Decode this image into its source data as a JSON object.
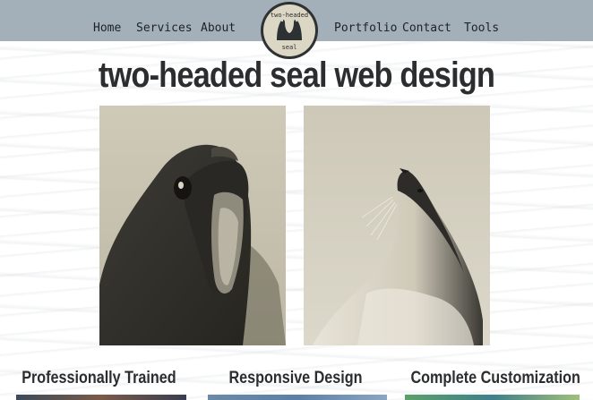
{
  "nav": {
    "left": [
      "Home",
      "Services",
      "About"
    ],
    "right": [
      "Portfolio",
      "Contact",
      "Tools"
    ]
  },
  "logo": {
    "top_text": "two-headed",
    "bottom_text": "seal"
  },
  "headline": "two-headed seal web design",
  "photos": [
    {
      "icon": "seal-yawning-photo"
    },
    {
      "icon": "seal-looking-up-photo"
    }
  ],
  "features": [
    "Professionally Trained",
    "Responsive Design",
    "Complete Customization"
  ],
  "colors": {
    "navbar": "#a3afb9",
    "text_dark": "#2b2d2f",
    "photo_tone": "#cdc7b6"
  }
}
